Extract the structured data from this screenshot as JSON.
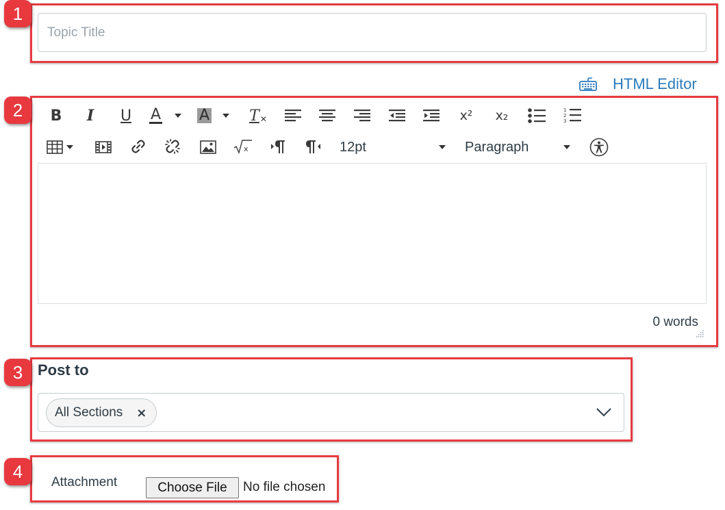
{
  "callouts": [
    "1",
    "2",
    "3",
    "4"
  ],
  "title_field": {
    "value": "",
    "placeholder": "Topic Title"
  },
  "editor": {
    "html_editor_label": "HTML Editor",
    "toolbar": {
      "bold": "B",
      "italic": "I",
      "underline": "U",
      "font_color": "A",
      "background_color": "A",
      "clear_format": "T",
      "superscript": "x²",
      "subscript": "x₂",
      "font_size": "12pt",
      "paragraph_format": "Paragraph"
    },
    "word_count": "0 words"
  },
  "post_to": {
    "label": "Post to",
    "selected_sections": [
      "All Sections"
    ]
  },
  "attachment": {
    "label": "Attachment",
    "button_label": "Choose File",
    "status": "No file chosen"
  },
  "colors": {
    "callout_red": "#e8393f",
    "link_blue": "#2b7abc",
    "text": "#2d3b45",
    "border": "#c7cdd1"
  }
}
